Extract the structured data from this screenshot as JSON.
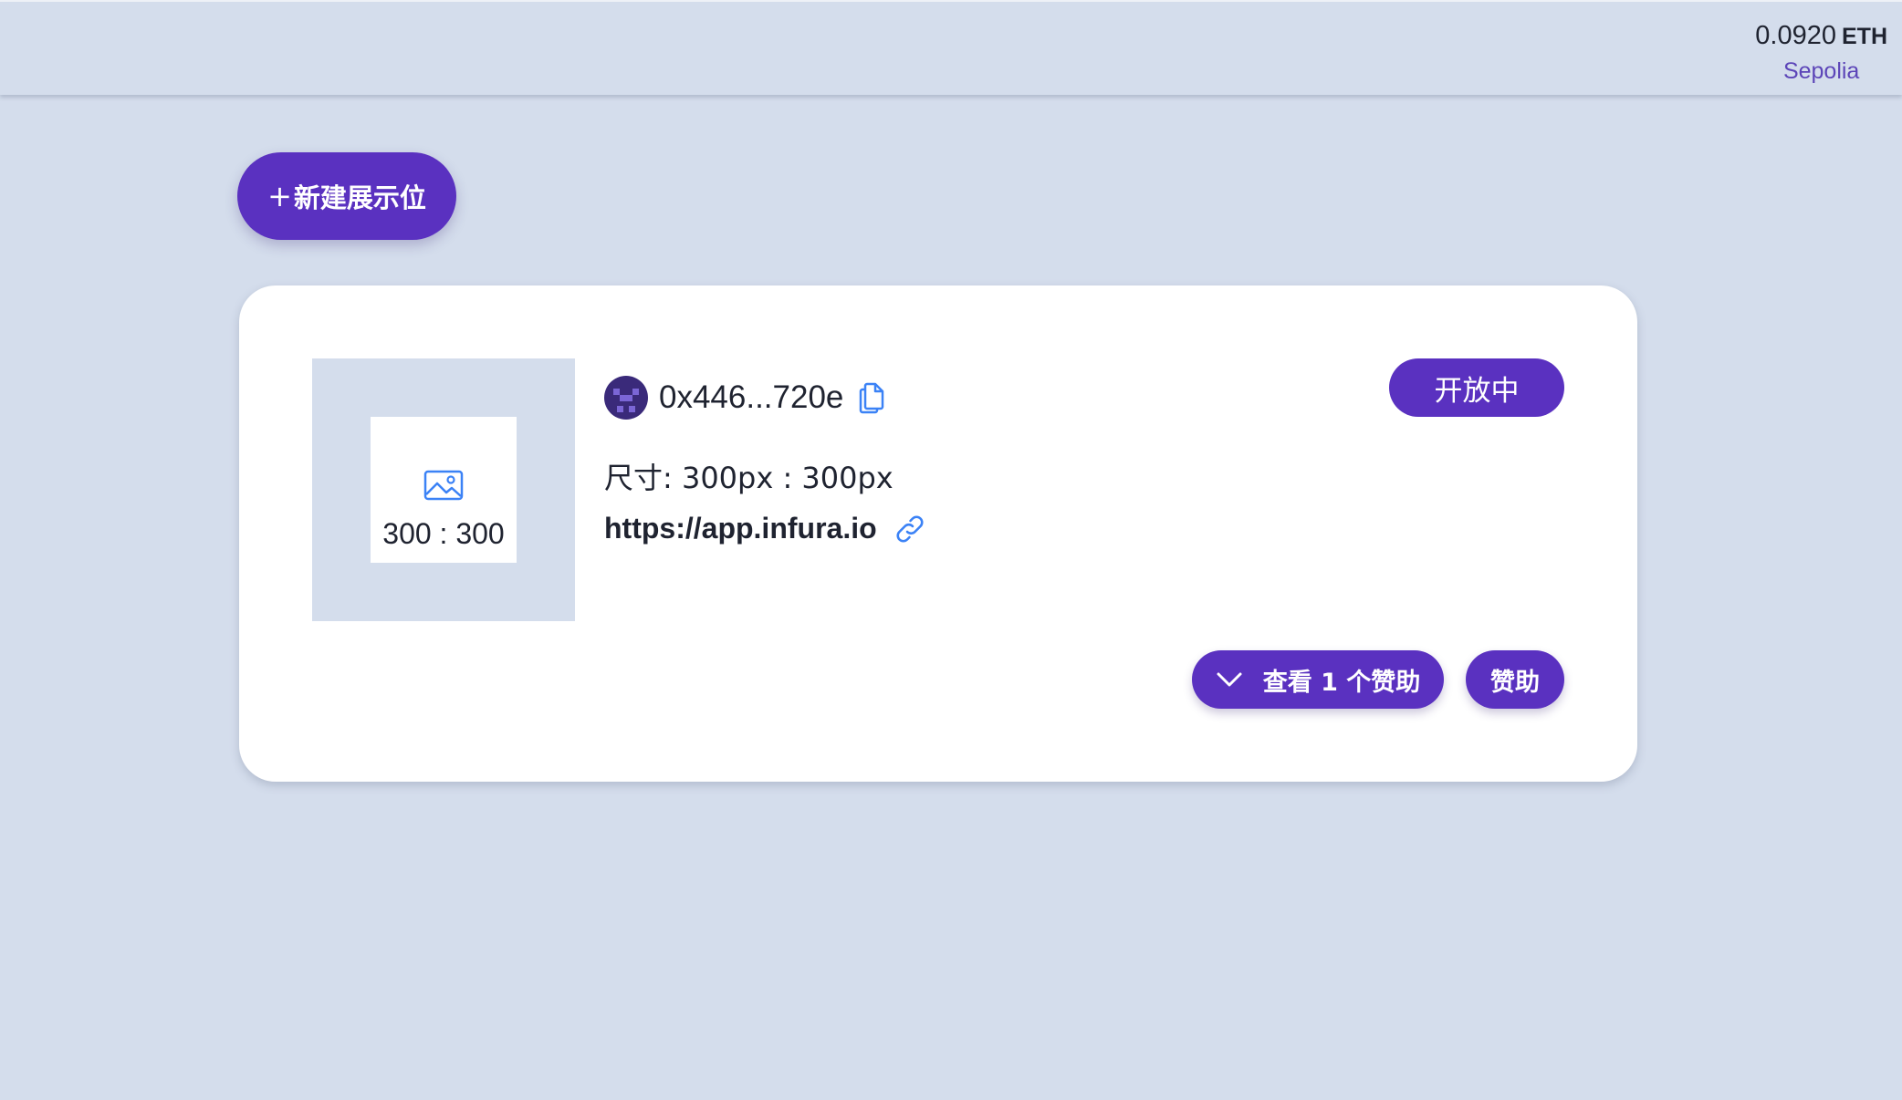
{
  "header": {
    "balance": "0.0920",
    "currency": "ETH",
    "network": "Sepolia"
  },
  "toolbar": {
    "new_slot_plus": "+",
    "new_slot_label": "新建展示位"
  },
  "slot": {
    "preview_ratio": "300 : 300",
    "preview_icon": "image-icon",
    "owner_address": "0x446...720e",
    "copy_icon": "copy-icon",
    "size_text": "尺寸: 300px : 300px",
    "url": "https://app.infura.io",
    "link_icon": "link-icon",
    "status": "开放中",
    "view_sponsors_label": "查看 1 个赞助",
    "sponsor_label": "赞助"
  },
  "colors": {
    "background": "#d4ddec",
    "accent": "#5a31c0",
    "icon_blue": "#3b82f6",
    "network_text": "#5c45b8"
  }
}
